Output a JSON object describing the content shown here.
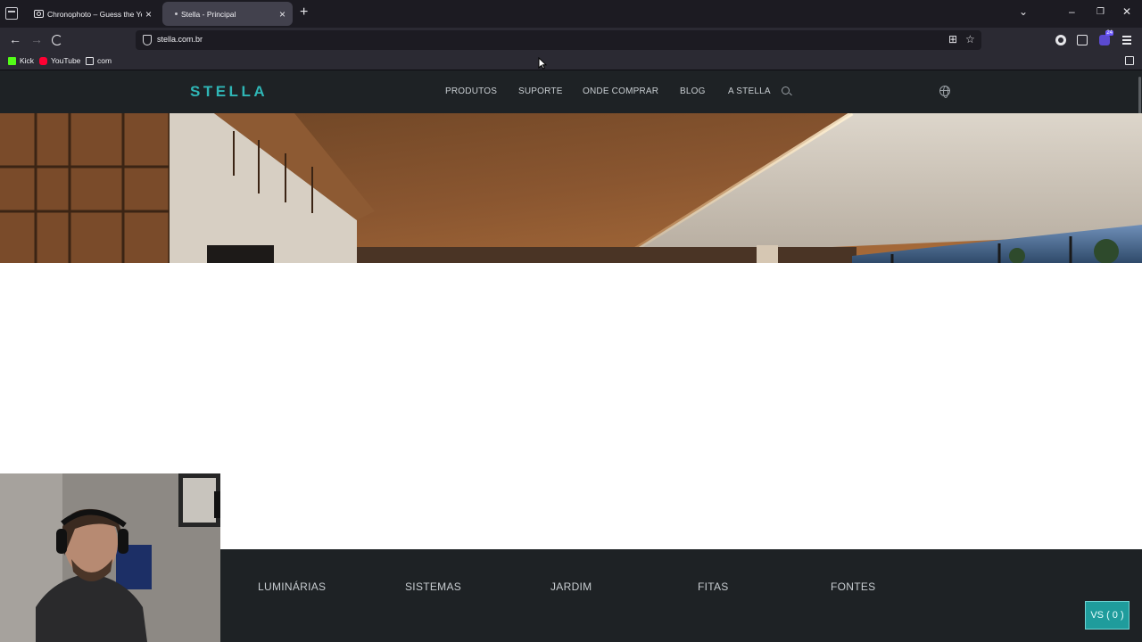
{
  "browser": {
    "tabs": [
      {
        "title": "Chronophoto – Guess the Year",
        "active": false
      },
      {
        "title": "Stella - Principal",
        "active": true
      }
    ],
    "url": "stella.com.br",
    "bookmarks": [
      {
        "label": "Kick",
        "icon": "kick-icon"
      },
      {
        "label": "YouTube",
        "icon": "youtube-icon"
      },
      {
        "label": "com",
        "icon": "folder-icon"
      }
    ],
    "extension_badge": "24"
  },
  "site": {
    "logo": "STELLA",
    "nav": [
      "PRODUTOS",
      "SUPORTE",
      "ONDE COMPRAR",
      "BLOG",
      "A STELLA"
    ],
    "categories": [
      "LUMINÁRIAS",
      "SISTEMAS",
      "JARDIM",
      "FITAS",
      "FONTES"
    ],
    "compare_button": "VS ( 0 )",
    "colors": {
      "brand": "#2fb6b6",
      "header_bg": "#1e2225",
      "button_bg": "#1f9c9c"
    }
  }
}
